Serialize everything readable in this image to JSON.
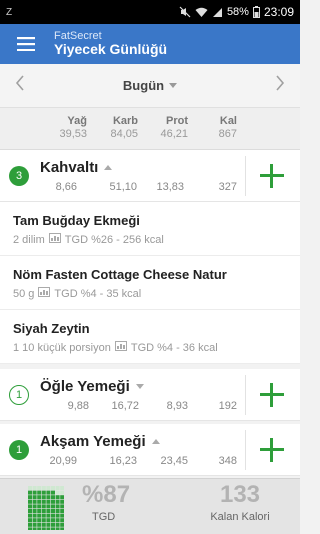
{
  "status_bar": {
    "left_indicator": "Z",
    "battery": "58%",
    "time": "23:09"
  },
  "app_bar": {
    "app_name": "FatSecret",
    "title": "Yiyecek Günlüğü"
  },
  "date_nav": {
    "label": "Bugün"
  },
  "totals": {
    "headers": [
      "Yağ",
      "Karb",
      "Prot",
      "Kal"
    ],
    "values": [
      "39,53",
      "84,05",
      "46,21",
      "867"
    ]
  },
  "meals": [
    {
      "badge": "3",
      "name": "Kahvaltı",
      "values": [
        "8,66",
        "51,10",
        "13,83",
        "327"
      ]
    },
    {
      "badge": "1",
      "name": "Öğle Yemeği",
      "values": [
        "9,88",
        "16,72",
        "8,93",
        "192"
      ]
    },
    {
      "badge": "1",
      "name": "Akşam Yemeği",
      "values": [
        "20,99",
        "16,23",
        "23,45",
        "348"
      ]
    }
  ],
  "foods": [
    {
      "name": "Tam Buğday Ekmeği",
      "portion": "2 dilim",
      "tgd": "TGD %26 - 256 kcal"
    },
    {
      "name": "Nöm Fasten Cottage Cheese Natur",
      "portion": "50 g",
      "tgd": "TGD %4 - 35 kcal"
    },
    {
      "name": "Siyah Zeytin",
      "portion": "1 10 küçük porsiyon",
      "tgd": "TGD %4 - 36 kcal"
    }
  ],
  "footer": {
    "percent": "%87",
    "percent_label": "TGD",
    "remaining": "133",
    "remaining_label": "Kalan Kalori",
    "progress_fraction": 0.87
  },
  "colors": {
    "app_bar": "#3a77c8",
    "accent_green": "#2e9e3a"
  }
}
